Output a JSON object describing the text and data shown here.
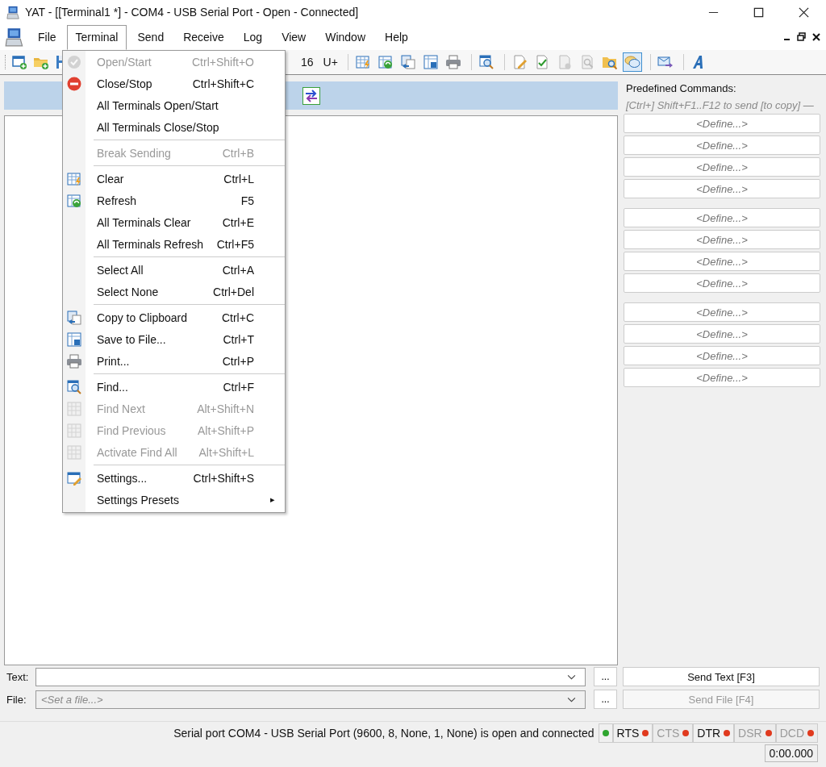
{
  "window": {
    "title": "YAT - [[Terminal1 *] - COM4 - USB Serial Port - Open - Connected]"
  },
  "menu_bar": [
    {
      "label": "File",
      "selected": false
    },
    {
      "label": "Terminal",
      "selected": true
    },
    {
      "label": "Send",
      "selected": false
    },
    {
      "label": "Receive",
      "selected": false
    },
    {
      "label": "Log",
      "selected": false
    },
    {
      "label": "View",
      "selected": false
    },
    {
      "label": "Window",
      "selected": false
    },
    {
      "label": "Help",
      "selected": false
    }
  ],
  "toolbar": {
    "radix_labels": [
      "16",
      "U+"
    ],
    "buttons": [
      {
        "pressed": false
      },
      {
        "pressed": false
      },
      {
        "pressed": false
      },
      {
        "pressed": false
      },
      {
        "pressed": false
      },
      {
        "pressed": false
      },
      {
        "pressed": false
      },
      {
        "pressed": false
      },
      {
        "pressed": false
      },
      {
        "pressed": false
      },
      {
        "pressed": false
      },
      {
        "pressed": true
      },
      {
        "pressed": false
      },
      {
        "pressed": false
      }
    ]
  },
  "terminal_menu": {
    "sections": [
      {
        "items": [
          {
            "label": "Open/Start",
            "shortcut": "Ctrl+Shift+O",
            "disabled": true
          },
          {
            "label": "Close/Stop",
            "shortcut": "Ctrl+Shift+C",
            "disabled": false
          },
          {
            "label": "All Terminals Open/Start",
            "disabled": false
          },
          {
            "label": "All Terminals Close/Stop",
            "disabled": false
          }
        ]
      },
      {
        "items": [
          {
            "label": "Break Sending",
            "shortcut": "Ctrl+B",
            "disabled": true
          }
        ]
      },
      {
        "items": [
          {
            "label": "Clear",
            "shortcut": "Ctrl+L",
            "disabled": false
          },
          {
            "label": "Refresh",
            "shortcut": "F5",
            "disabled": false
          },
          {
            "label": "All Terminals Clear",
            "shortcut": "Ctrl+E",
            "disabled": false
          },
          {
            "label": "All Terminals Refresh",
            "shortcut": "Ctrl+F5",
            "disabled": false
          }
        ]
      },
      {
        "items": [
          {
            "label": "Select All",
            "shortcut": "Ctrl+A",
            "disabled": false
          },
          {
            "label": "Select None",
            "shortcut": "Ctrl+Del",
            "disabled": false
          }
        ]
      },
      {
        "items": [
          {
            "label": "Copy to Clipboard",
            "shortcut": "Ctrl+C",
            "disabled": false
          },
          {
            "label": "Save to File...",
            "shortcut": "Ctrl+T",
            "disabled": false
          },
          {
            "label": "Print...",
            "shortcut": "Ctrl+P",
            "disabled": false
          }
        ]
      },
      {
        "items": [
          {
            "label": "Find...",
            "shortcut": "Ctrl+F",
            "disabled": false
          },
          {
            "label": "Find Next",
            "shortcut": "Alt+Shift+N",
            "disabled": true
          },
          {
            "label": "Find Previous",
            "shortcut": "Alt+Shift+P",
            "disabled": true
          },
          {
            "label": "Activate Find All",
            "shortcut": "Alt+Shift+L",
            "disabled": true
          }
        ]
      },
      {
        "items": [
          {
            "label": "Settings...",
            "shortcut": "Ctrl+Shift+S",
            "disabled": false
          },
          {
            "label": "Settings Presets",
            "submenu": "▸",
            "disabled": false
          }
        ]
      }
    ]
  },
  "predefined": {
    "title": "Predefined Commands:",
    "hint": "[Ctrl+] Shift+F1..F12 to send [to copy] —",
    "groups": [
      [
        "<Define...>",
        "<Define...>",
        "<Define...>",
        "<Define...>"
      ],
      [
        "<Define...>",
        "<Define...>",
        "<Define...>",
        "<Define...>"
      ],
      [
        "<Define...>",
        "<Define...>",
        "<Define...>",
        "<Define...>"
      ]
    ]
  },
  "send": {
    "text_label": "Text:",
    "file_label": "File:",
    "file_placeholder": "<Set a file...>",
    "browse_text": "...",
    "browse_file": "...",
    "send_text": {
      "label": "Send Text [F3]",
      "disabled": false
    },
    "send_file": {
      "label": "Send File [F4]",
      "disabled": true
    }
  },
  "status_bar": {
    "message": "Serial port COM4 - USB Serial Port (9600, 8, None, 1, None) is open and connected",
    "indicators": [
      {
        "color": "#2fa52f"
      },
      {
        "label": "RTS",
        "color": "#e03a1e",
        "disabled": false
      },
      {
        "label": "CTS",
        "color": "#e03a1e",
        "disabled": true
      },
      {
        "label": "DTR",
        "color": "#e03a1e",
        "disabled": false
      },
      {
        "label": "DSR",
        "color": "#e03a1e",
        "disabled": true
      },
      {
        "label": "DCD",
        "color": "#e03a1e",
        "disabled": true
      }
    ],
    "timer": "0:00.000"
  }
}
